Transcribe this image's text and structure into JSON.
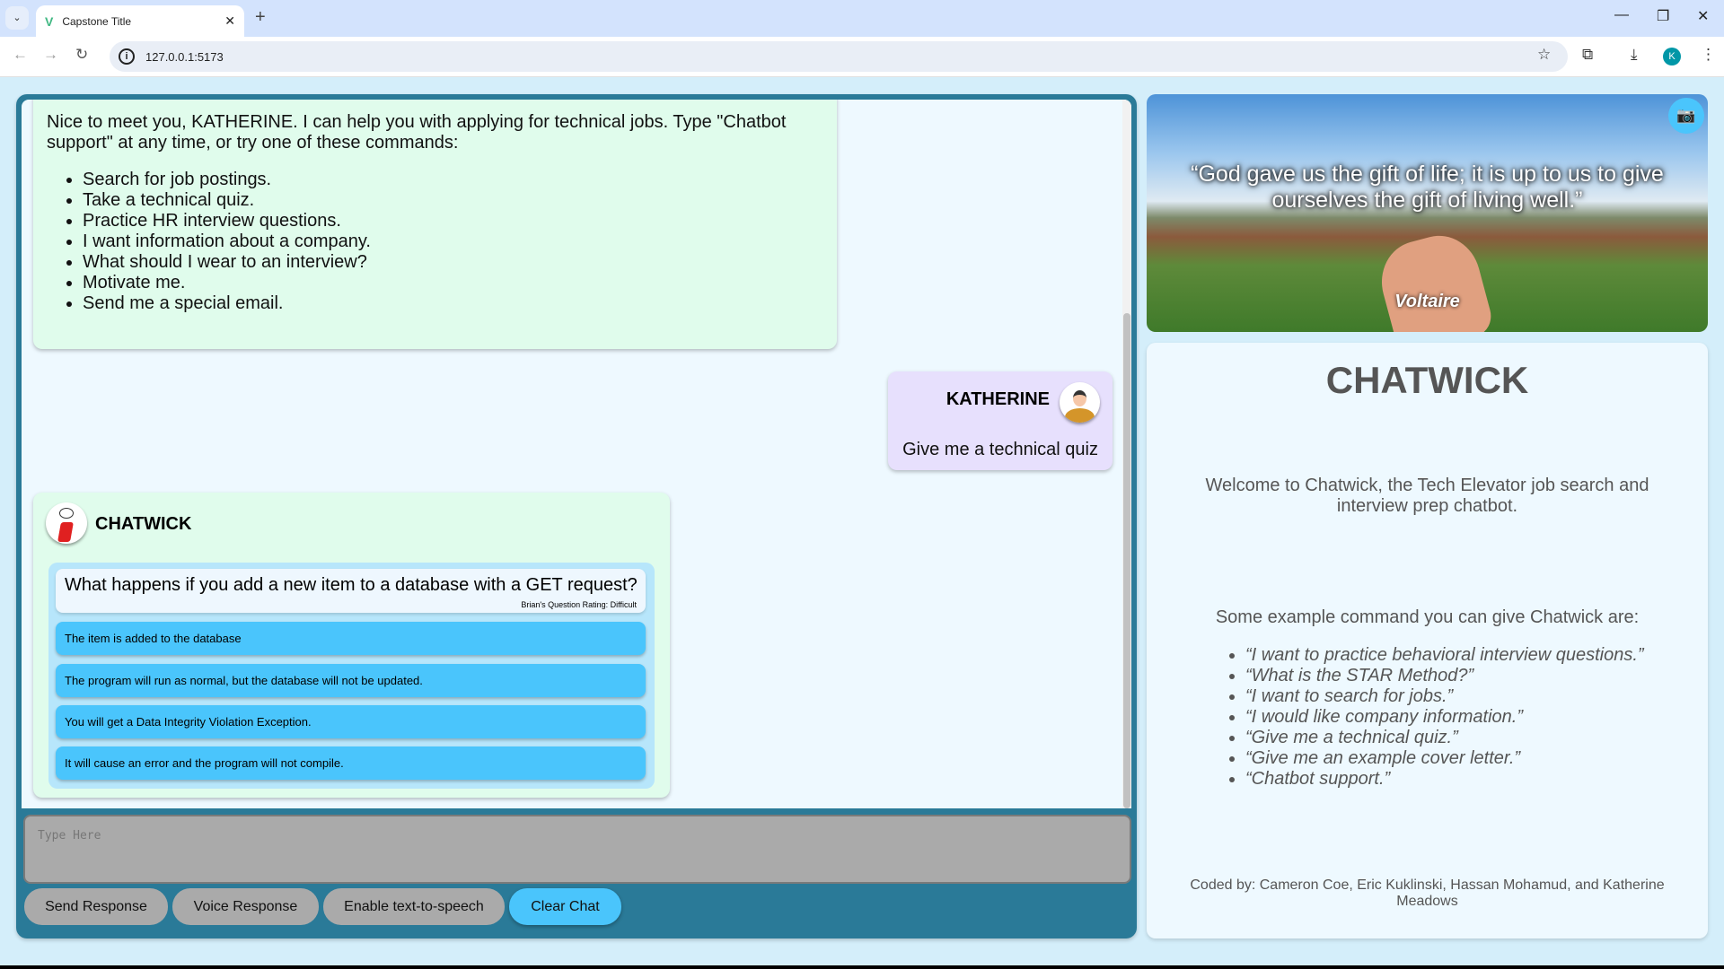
{
  "browser": {
    "tab_title": "Capstone Title",
    "url": "127.0.0.1:5173",
    "profile_initial": "K"
  },
  "chat": {
    "intro": {
      "text": "Nice to meet you, KATHERINE. I can help you with applying for technical jobs. Type \"Chatbot support\" at any time, or try one of these commands:",
      "commands": [
        "Search for job postings.",
        "Take a technical quiz.",
        "Practice HR interview questions.",
        "I want information about a company.",
        "What should I wear to an interview?",
        "Motivate me.",
        "Send me a special email."
      ]
    },
    "user_message": {
      "name": "KATHERINE",
      "text": "Give me a technical quiz"
    },
    "bot_message": {
      "name": "CHATWICK",
      "question": "What happens if you add a new item to a database with a GET request?",
      "rating": "Brian's Question Rating: Difficult",
      "options": [
        "The item is added to the database",
        "The program will run as normal, but the database will not be updated.",
        "You will get a Data Integrity Violation Exception.",
        "It will cause an error and the program will not compile."
      ]
    }
  },
  "input": {
    "placeholder": "Type Here"
  },
  "buttons": {
    "send": "Send Response",
    "voice": "Voice Response",
    "tts": "Enable text-to-speech",
    "clear": "Clear Chat"
  },
  "quote": {
    "text": "“God gave us the gift of life; it is up to us to give ourselves the gift of living well.”",
    "author": "Voltaire"
  },
  "info": {
    "title": "CHATWICK",
    "welcome": "Welcome to Chatwick, the Tech Elevator job search and interview prep chatbot.",
    "examples_heading": "Some example command you can give Chatwick are:",
    "examples": [
      "“I want to practice behavioral interview questions.”",
      "“What is the STAR Method?”",
      "“I want to search for jobs.”",
      "“I would like company information.”",
      "“Give me a technical quiz.”",
      "“Give me an example cover letter.”",
      "“Chatbot support.”"
    ],
    "coded_by": "Coded by: Cameron Coe, Eric Kuklinski, Hassan Mohamud, and Katherine Meadows"
  },
  "colors": {
    "panel": "#2a7a98",
    "accent": "#4ac5fc",
    "bot_bubble": "#e0fcec",
    "user_bubble": "#e7e0fd"
  }
}
